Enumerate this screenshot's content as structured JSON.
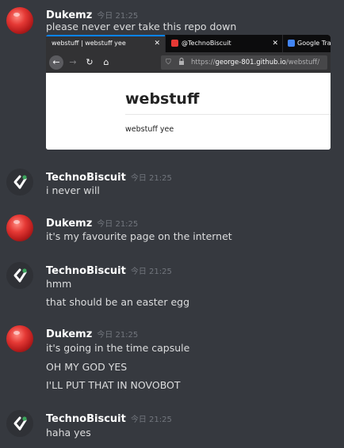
{
  "messages": [
    {
      "username": "Dukemz",
      "timestamp": "今日 21:25",
      "lines": [
        "please never ever take this repo down"
      ],
      "embed": {
        "tabs": [
          {
            "label": "webstuff | webstuff yee",
            "close": "✕"
          },
          {
            "label": "@TechnoBiscuit",
            "close": "✕"
          },
          {
            "label": "Google Tra"
          }
        ],
        "url_prefix": "https://",
        "url_host": "george-801.github.io",
        "url_path": "/webstuff/",
        "page_heading": "webstuff",
        "page_text": "webstuff yee"
      }
    },
    {
      "username": "TechnoBiscuit",
      "timestamp": "今日 21:25",
      "lines": [
        "i never will"
      ]
    },
    {
      "username": "Dukemz",
      "timestamp": "今日 21:25",
      "lines": [
        "it's my favourite page on the internet"
      ]
    },
    {
      "username": "TechnoBiscuit",
      "timestamp": "今日 21:25",
      "lines": [
        "hmm",
        "that should be an easter egg"
      ]
    },
    {
      "username": "Dukemz",
      "timestamp": "今日 21:25",
      "lines": [
        "it's going in the time capsule",
        "OH MY GOD YES",
        "I'LL PUT THAT IN NOVOBOT"
      ]
    },
    {
      "username": "TechnoBiscuit",
      "timestamp": "今日 21:25",
      "lines": [
        "haha yes"
      ]
    }
  ],
  "colors": {
    "background": "#36393f",
    "username": "#ffffff",
    "text": "#dcddde",
    "timestamp": "#72767d",
    "tab_accent": "#0a84ff"
  }
}
